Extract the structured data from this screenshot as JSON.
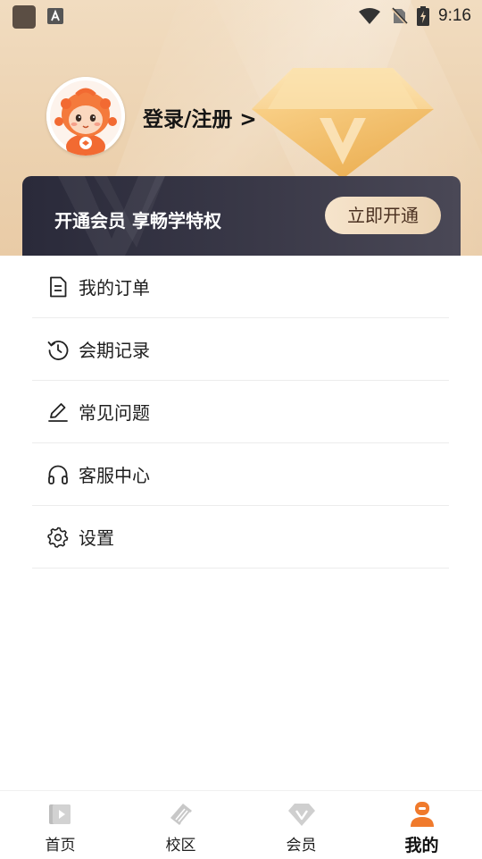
{
  "status_bar": {
    "time": "9:16"
  },
  "profile": {
    "login_label": "登录/注册 >"
  },
  "vip_banner": {
    "text": "开通会员 享畅学特权",
    "button_label": "立即开通"
  },
  "menu": {
    "items": [
      {
        "label": "我的订单",
        "icon": "document-icon"
      },
      {
        "label": "会期记录",
        "icon": "history-icon"
      },
      {
        "label": "常见问题",
        "icon": "edit-icon"
      },
      {
        "label": "客服中心",
        "icon": "headset-icon"
      },
      {
        "label": "设置",
        "icon": "gear-icon"
      }
    ]
  },
  "tabbar": {
    "active_index": 3,
    "tabs": [
      {
        "label": "首页",
        "icon": "video-icon"
      },
      {
        "label": "校区",
        "icon": "campus-icon"
      },
      {
        "label": "会员",
        "icon": "diamond-icon"
      },
      {
        "label": "我的",
        "icon": "user-icon"
      }
    ]
  },
  "colors": {
    "accent": "#f07a2c",
    "header_bg": "#ecd2b0",
    "banner_bg": "#2f2f3e",
    "button_bg": "#f0dcc0"
  }
}
